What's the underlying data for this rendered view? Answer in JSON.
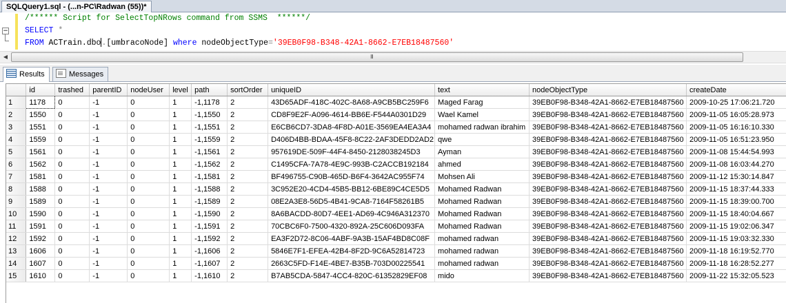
{
  "document_tab": "SQLQuery1.sql - (...n-PC\\Radwan (55))*",
  "editor": {
    "comment": "/****** Script for SelectTopNRows command from SSMS  ******/",
    "select_kw": "SELECT",
    "star": "*",
    "from_kw": "FROM",
    "table_a": "ACTrain.dbo",
    "dot": ".",
    "table_b": "[umbracoNode]",
    "where_kw": "where",
    "column": "nodeObjectType",
    "eq": "=",
    "value": "'39EB0F98-B348-42A1-8662-E7EB18487560'",
    "fold_glyph": "−"
  },
  "scrollbar": {
    "left_arrow": "◀",
    "grip": "III"
  },
  "tabs": {
    "results": "Results",
    "messages": "Messages"
  },
  "grid": {
    "columns": [
      "id",
      "trashed",
      "parentID",
      "nodeUser",
      "level",
      "path",
      "sortOrder",
      "uniqueID",
      "text",
      "nodeObjectType",
      "createDate"
    ],
    "rows": [
      [
        "1",
        "1178",
        "0",
        "-1",
        "0",
        "1",
        "-1,1178",
        "2",
        "43D65ADF-418C-402C-8A68-A9CB5BC259F6",
        "Maged Farag",
        "39EB0F98-B348-42A1-8662-E7EB18487560",
        "2009-10-25 17:06:21.720"
      ],
      [
        "2",
        "1550",
        "0",
        "-1",
        "0",
        "1",
        "-1,1550",
        "2",
        "CD8F9E2F-A096-4614-BB6E-F544A0301D29",
        "Wael Kamel",
        "39EB0F98-B348-42A1-8662-E7EB18487560",
        "2009-11-05 16:05:28.973"
      ],
      [
        "3",
        "1551",
        "0",
        "-1",
        "0",
        "1",
        "-1,1551",
        "2",
        "E6CB6CD7-3DA8-4F8D-A01E-3569EA4EA3A4",
        "mohamed radwan ibrahim",
        "39EB0F98-B348-42A1-8662-E7EB18487560",
        "2009-11-05 16:16:10.330"
      ],
      [
        "4",
        "1559",
        "0",
        "-1",
        "0",
        "1",
        "-1,1559",
        "2",
        "D406D4BB-BDAA-45F8-8C22-2AF3DEDD2AD2",
        "qwe",
        "39EB0F98-B348-42A1-8662-E7EB18487560",
        "2009-11-05 16:51:23.950"
      ],
      [
        "5",
        "1561",
        "0",
        "-1",
        "0",
        "1",
        "-1,1561",
        "2",
        "957619DE-509F-44F4-8450-2128038245D3",
        "Ayman",
        "39EB0F98-B348-42A1-8662-E7EB18487560",
        "2009-11-08 15:44:54.993"
      ],
      [
        "6",
        "1562",
        "0",
        "-1",
        "0",
        "1",
        "-1,1562",
        "2",
        "C1495CFA-7A78-4E9C-993B-C2ACCB192184",
        "ahmed",
        "39EB0F98-B348-42A1-8662-E7EB18487560",
        "2009-11-08 16:03:44.270"
      ],
      [
        "7",
        "1581",
        "0",
        "-1",
        "0",
        "1",
        "-1,1581",
        "2",
        "BF496755-C90B-465D-B6F4-3642AC955F74",
        "Mohsen Ali",
        "39EB0F98-B348-42A1-8662-E7EB18487560",
        "2009-11-12 15:30:14.847"
      ],
      [
        "8",
        "1588",
        "0",
        "-1",
        "0",
        "1",
        "-1,1588",
        "2",
        "3C952E20-4CD4-45B5-BB12-6BE89C4CE5D5",
        "Mohamed Radwan",
        "39EB0F98-B348-42A1-8662-E7EB18487560",
        "2009-11-15 18:37:44.333"
      ],
      [
        "9",
        "1589",
        "0",
        "-1",
        "0",
        "1",
        "-1,1589",
        "2",
        "08E2A3E8-56D5-4B41-9CA8-7164F58261B5",
        "Mohamed Radwan",
        "39EB0F98-B348-42A1-8662-E7EB18487560",
        "2009-11-15 18:39:00.700"
      ],
      [
        "10",
        "1590",
        "0",
        "-1",
        "0",
        "1",
        "-1,1590",
        "2",
        "8A6BACDD-80D7-4EE1-AD69-4C946A312370",
        "Mohamed Radwan",
        "39EB0F98-B348-42A1-8662-E7EB18487560",
        "2009-11-15 18:40:04.667"
      ],
      [
        "11",
        "1591",
        "0",
        "-1",
        "0",
        "1",
        "-1,1591",
        "2",
        "70CBC6F0-7500-4320-892A-25C606D093FA",
        "Mohamed Radwan",
        "39EB0F98-B348-42A1-8662-E7EB18487560",
        "2009-11-15 19:02:06.347"
      ],
      [
        "12",
        "1592",
        "0",
        "-1",
        "0",
        "1",
        "-1,1592",
        "2",
        "EA3F2D72-8C06-4ABF-9A3B-15AF4BD8C08F",
        "mohamed radwan",
        "39EB0F98-B348-42A1-8662-E7EB18487560",
        "2009-11-15 19:03:32.330"
      ],
      [
        "13",
        "1606",
        "0",
        "-1",
        "0",
        "1",
        "-1,1606",
        "2",
        "5846E7F1-EFEA-42B4-8F2D-9C6A52814723",
        "mohamed radwan",
        "39EB0F98-B348-42A1-8662-E7EB18487560",
        "2009-11-18 16:19:52.770"
      ],
      [
        "14",
        "1607",
        "0",
        "-1",
        "0",
        "1",
        "-1,1607",
        "2",
        "2663C5FD-F14E-4BE7-B35B-703D00225541",
        "mohamed radwan",
        "39EB0F98-B348-42A1-8662-E7EB18487560",
        "2009-11-18 16:28:52.277"
      ],
      [
        "15",
        "1610",
        "0",
        "-1",
        "0",
        "1",
        "-1,1610",
        "2",
        "B7AB5CDA-5847-4CC4-820C-61352829EF08",
        "mido",
        "39EB0F98-B348-42A1-8662-E7EB18487560",
        "2009-11-22 15:32:05.523"
      ]
    ]
  }
}
